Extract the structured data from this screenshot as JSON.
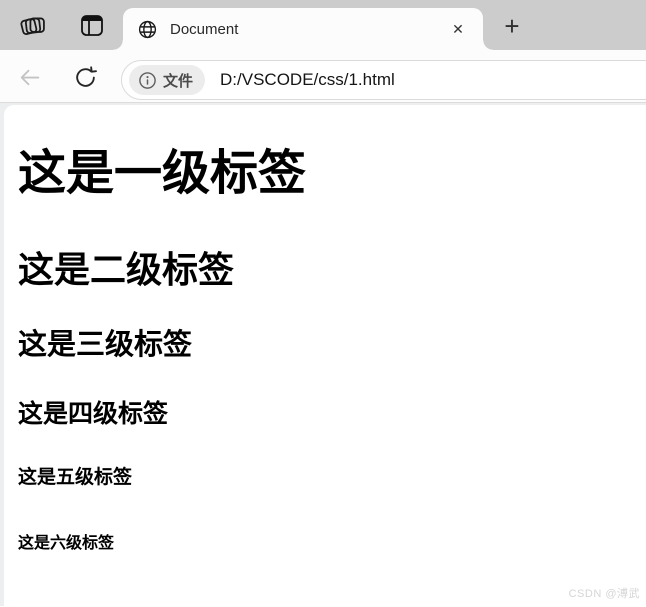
{
  "colors": {
    "tab_strip_bg": "#cccccc",
    "chrome_surface": "#fcfcfc",
    "frame_gap": "#eceef0",
    "page_bg": "#ffffff",
    "heading_text": "#000000",
    "watermark_text": "#d5d5d7"
  },
  "browser": {
    "tab_title": "Document",
    "scheme_label": "文件",
    "url": "D:/VSCODE/css/1.html",
    "icons": {
      "close": "✕",
      "new_tab": "+"
    }
  },
  "page": {
    "headings": [
      {
        "level": "h1",
        "text": "这是一级标签"
      },
      {
        "level": "h2",
        "text": "这是二级标签"
      },
      {
        "level": "h3",
        "text": "这是三级标签"
      },
      {
        "level": "h4",
        "text": "这是四级标签"
      },
      {
        "level": "h5",
        "text": "这是五级标签"
      },
      {
        "level": "h6",
        "text": "这是六级标签"
      }
    ],
    "watermark": "CSDN @溥武"
  }
}
